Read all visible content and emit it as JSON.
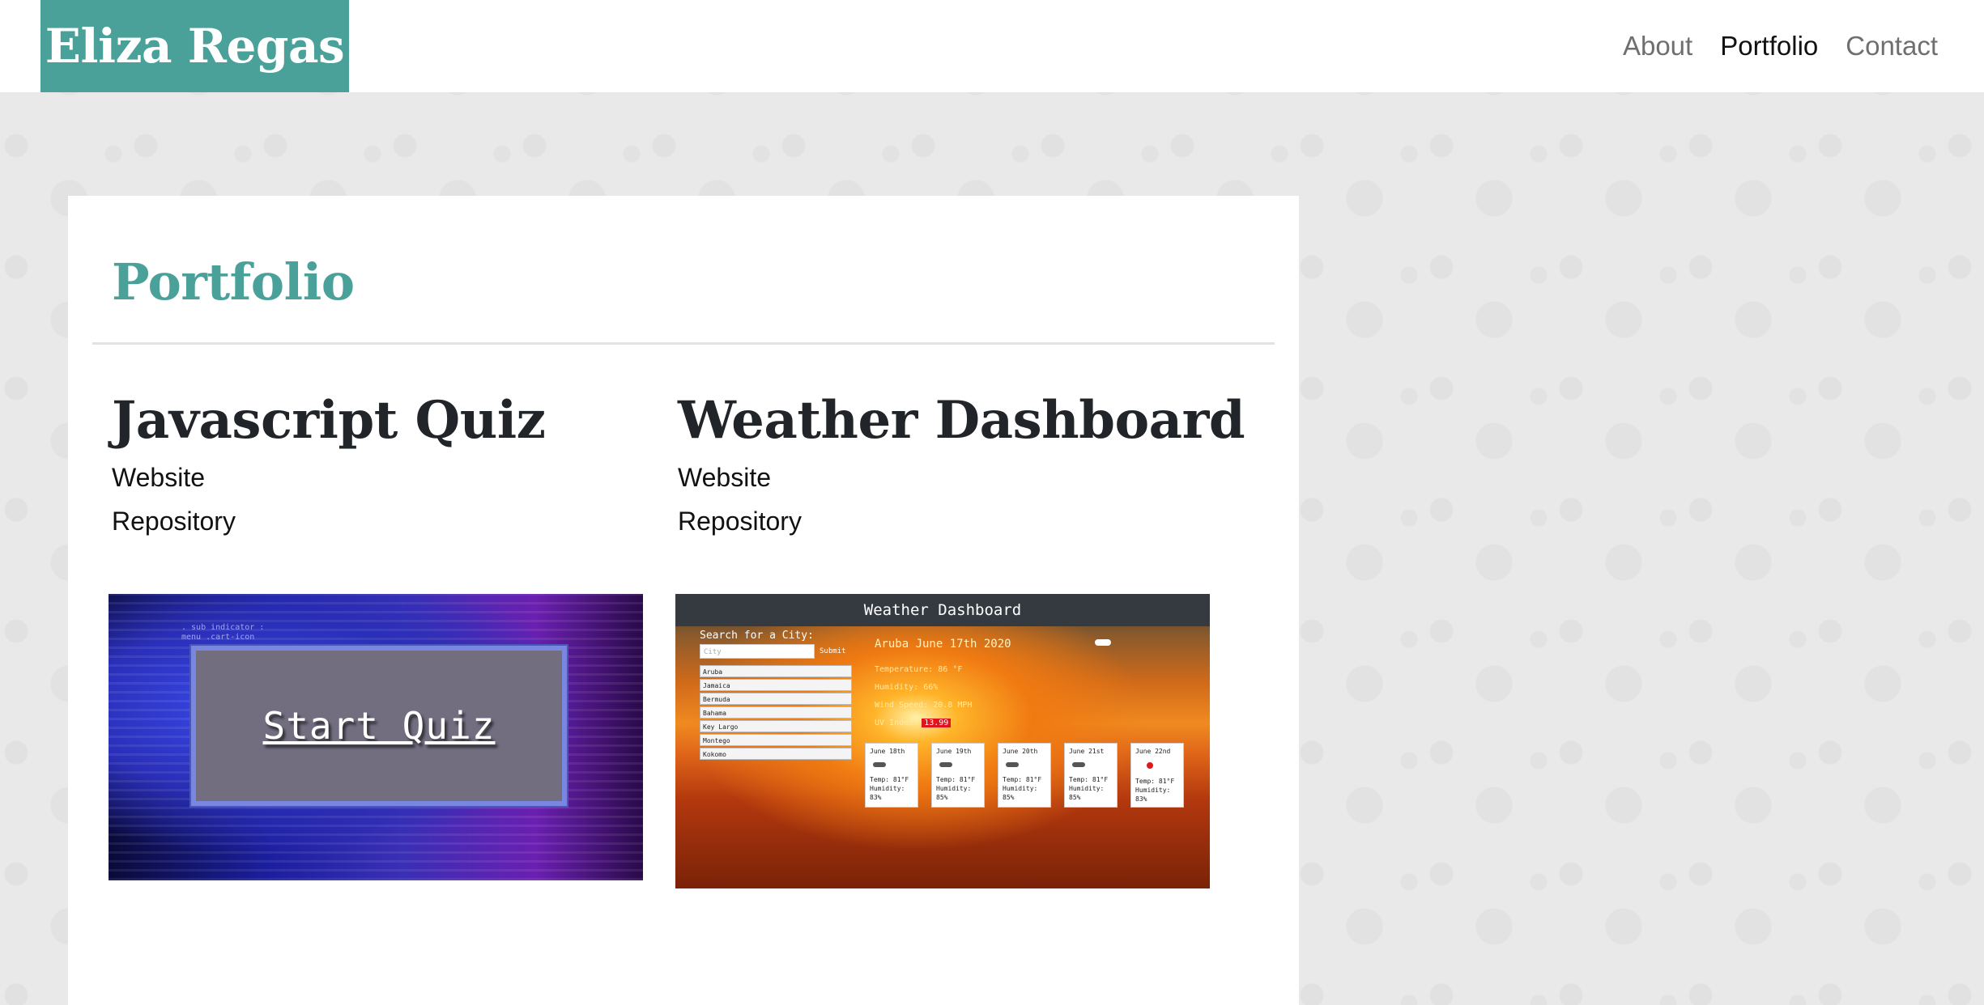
{
  "header": {
    "brand": "Eliza Regas",
    "nav": [
      {
        "label": "About",
        "active": false
      },
      {
        "label": "Portfolio",
        "active": true
      },
      {
        "label": "Contact",
        "active": false
      }
    ]
  },
  "main": {
    "title": "Portfolio",
    "projects": [
      {
        "name": "Javascript Quiz",
        "website_label": "Website",
        "repository_label": "Repository",
        "screenshot": {
          "button_text": "Start Quiz",
          "code_text": ". sub indicator :\nmenu .cart-icon"
        }
      },
      {
        "name": "Weather Dashboard",
        "website_label": "Website",
        "repository_label": "Repository",
        "screenshot": {
          "header": "Weather Dashboard",
          "search_label": "Search for a City:",
          "search_placeholder": "City",
          "submit_label": "Submit",
          "cities": [
            "Aruba",
            "Jamaica",
            "Bermuda",
            "Bahama",
            "Key Largo",
            "Montego",
            "Kokomo"
          ],
          "current": "Aruba June 17th 2020",
          "temperature": "Temperature: 86 °F",
          "humidity": "Humidity: 66%",
          "wind": "Wind Speed: 20.8 MPH",
          "uv_label": "UV Index:",
          "uv_value": "13.99",
          "forecast": [
            {
              "date": "June 18th",
              "temp": "Temp: 81°F",
              "humidity": "Humidity: 83%",
              "icon": "cloud-icon"
            },
            {
              "date": "June 19th",
              "temp": "Temp: 81°F",
              "humidity": "Humidity: 85%",
              "icon": "cloud-icon"
            },
            {
              "date": "June 20th",
              "temp": "Temp: 81°F",
              "humidity": "Humidity: 85%",
              "icon": "cloud-icon"
            },
            {
              "date": "June 21st",
              "temp": "Temp: 81°F",
              "humidity": "Humidity: 85%",
              "icon": "cloud-icon"
            },
            {
              "date": "June 22nd",
              "temp": "Temp: 81°F",
              "humidity": "Humidity: 83%",
              "icon": "sun-icon"
            }
          ]
        }
      }
    ]
  },
  "colors": {
    "accent": "#4aa19a",
    "heading": "#212529",
    "nav_inactive": "#6f6f6f"
  }
}
